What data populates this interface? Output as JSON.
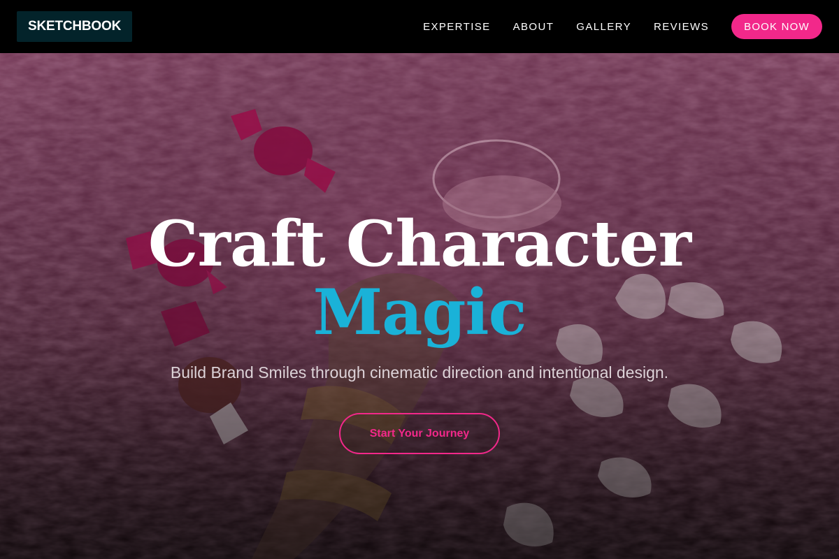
{
  "brand": {
    "logo_text": "SKETCHBOOK"
  },
  "nav": {
    "links": [
      {
        "label": "EXPERTISE"
      },
      {
        "label": "ABOUT"
      },
      {
        "label": "GALLERY"
      },
      {
        "label": "REVIEWS"
      }
    ],
    "cta_label": "BOOK NOW"
  },
  "hero": {
    "headline_line1": "Craft Character",
    "headline_line2": "Magic",
    "subtitle": "Build Brand Smiles through cinematic direction and intentional design.",
    "cta_label": "Start Your Journey"
  },
  "colors": {
    "accent_pink": "#f2288a",
    "accent_cyan": "#1ab2d8",
    "logo_bg": "#03232a"
  }
}
